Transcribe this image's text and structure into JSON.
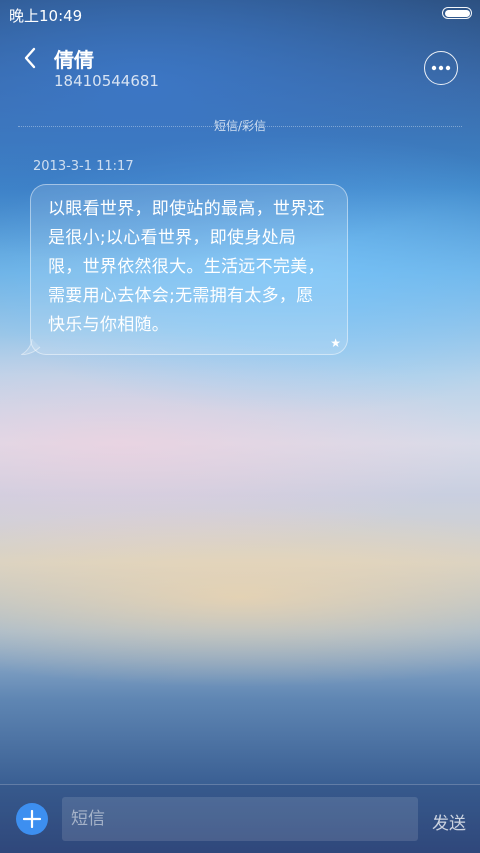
{
  "status_bar": {
    "time": "晚上10:49",
    "icons": [
      "battery-icon"
    ]
  },
  "header": {
    "back_icon": "chevron-left-icon",
    "contact_name": "倩倩",
    "contact_number": "18410544681",
    "more_icon": "more-dots-icon"
  },
  "thread": {
    "divider_label": "短信/彩信",
    "messages": [
      {
        "timestamp": "2013-3-1 11:17",
        "text": "以眼看世界，即使站的最高，世界还是很小;以心看世界，即使身处局限，世界依然很大。生活远不完美，需要用心去体会;无需拥有太多，愿快乐与你相随。",
        "starred": true,
        "star_icon": "★"
      }
    ]
  },
  "compose": {
    "add_icon": "plus-icon",
    "placeholder": "短信",
    "value": "",
    "send_label": "发送"
  },
  "colors": {
    "accent": "#3d8ff0",
    "text": "#ffffff"
  }
}
